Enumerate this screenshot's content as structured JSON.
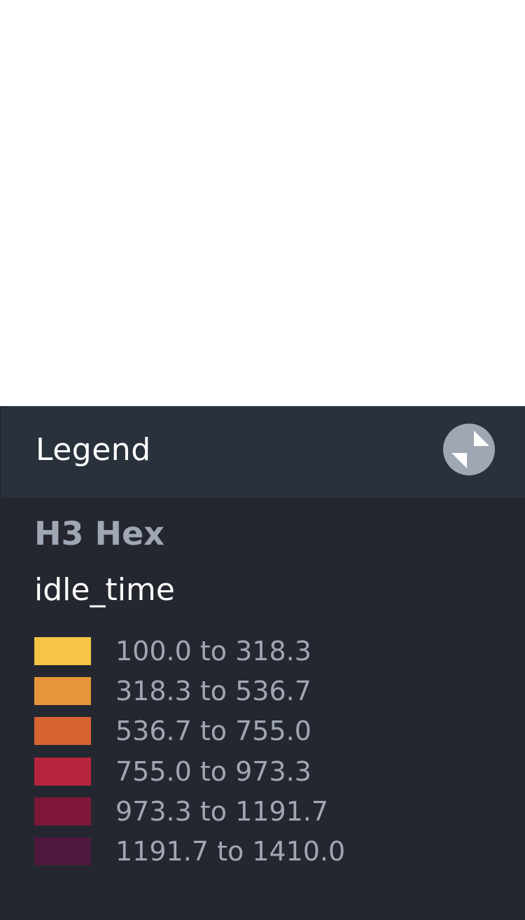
{
  "legend": {
    "title": "Legend",
    "collapse_icon": "collapse-arrows-icon",
    "layer_name": "H3 Hex",
    "field_name": "idle_time",
    "items": [
      {
        "label": "100.0 to 318.3",
        "color": "#f6c545"
      },
      {
        "label": "318.3 to 536.7",
        "color": "#e7953a"
      },
      {
        "label": "536.7 to 755.0",
        "color": "#d66432"
      },
      {
        "label": "755.0 to 973.3",
        "color": "#b6253e"
      },
      {
        "label": "973.3 to 1191.7",
        "color": "#7e1738"
      },
      {
        "label": "1191.7 to 1410.0",
        "color": "#4d1a3e"
      }
    ]
  }
}
